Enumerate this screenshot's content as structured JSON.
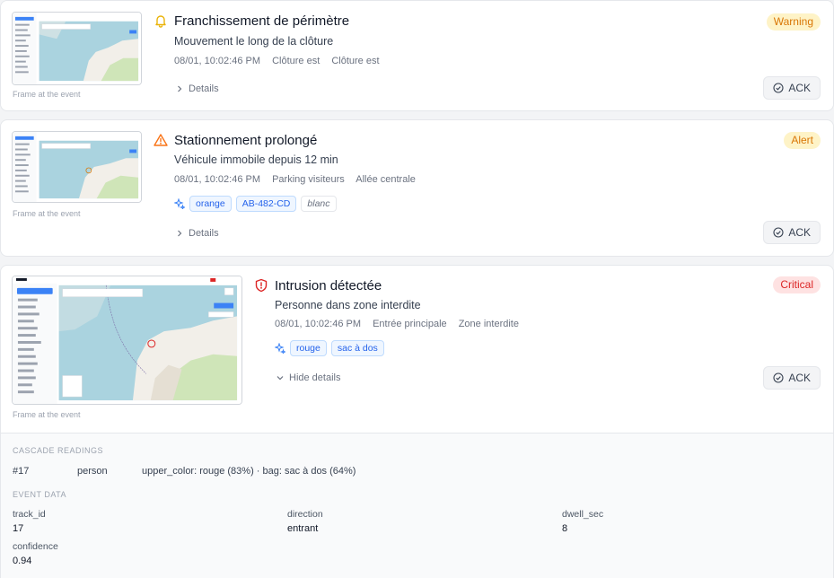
{
  "events": [
    {
      "title": "Franchissement de périmètre",
      "subtitle": "Mouvement le long de la clôture",
      "timestamp": "08/01, 10:02:46 PM",
      "meta": [
        "Clôture est",
        "Clôture est"
      ],
      "severity": "Warning",
      "severity_icon": "bell-icon",
      "details_label": "Details",
      "ack_label": "ACK",
      "frame_caption": "Frame at the event",
      "tags": []
    },
    {
      "title": "Stationnement prolongé",
      "subtitle": "Véhicule immobile depuis 12 min",
      "timestamp": "08/01, 10:02:46 PM",
      "meta": [
        "Parking visiteurs",
        "Allée centrale"
      ],
      "severity": "Alert",
      "severity_icon": "warning-triangle-icon",
      "details_label": "Details",
      "ack_label": "ACK",
      "frame_caption": "Frame at the event",
      "tags": [
        "orange",
        "AB-482-CD",
        "blanc"
      ]
    },
    {
      "title": "Intrusion détectée",
      "subtitle": "Personne dans zone interdite",
      "timestamp": "08/01, 10:02:46 PM",
      "meta": [
        "Entrée principale",
        "Zone interdite"
      ],
      "severity": "Critical",
      "severity_icon": "shield-alert-icon",
      "details_label": "Hide details",
      "ack_label": "ACK",
      "frame_caption": "Frame at the event",
      "tags": [
        "rouge",
        "sac à dos"
      ]
    }
  ],
  "cascade": {
    "label": "CASCADE READINGS",
    "rows": [
      {
        "id": "#17",
        "class": "person",
        "readings": "upper_color: rouge (83%) · bag: sac à dos (64%)"
      }
    ]
  },
  "event_data": {
    "label": "EVENT DATA",
    "fields": [
      {
        "key": "track_id",
        "value": "17"
      },
      {
        "key": "direction",
        "value": "entrant"
      },
      {
        "key": "dwell_sec",
        "value": "8"
      },
      {
        "key": "confidence",
        "value": "0.94"
      }
    ]
  },
  "colors": {
    "warning": "#d97706",
    "critical": "#dc2626",
    "tag_accent": "#2563eb",
    "map_sea": "#aad3df",
    "map_land": "#f2efe9"
  }
}
